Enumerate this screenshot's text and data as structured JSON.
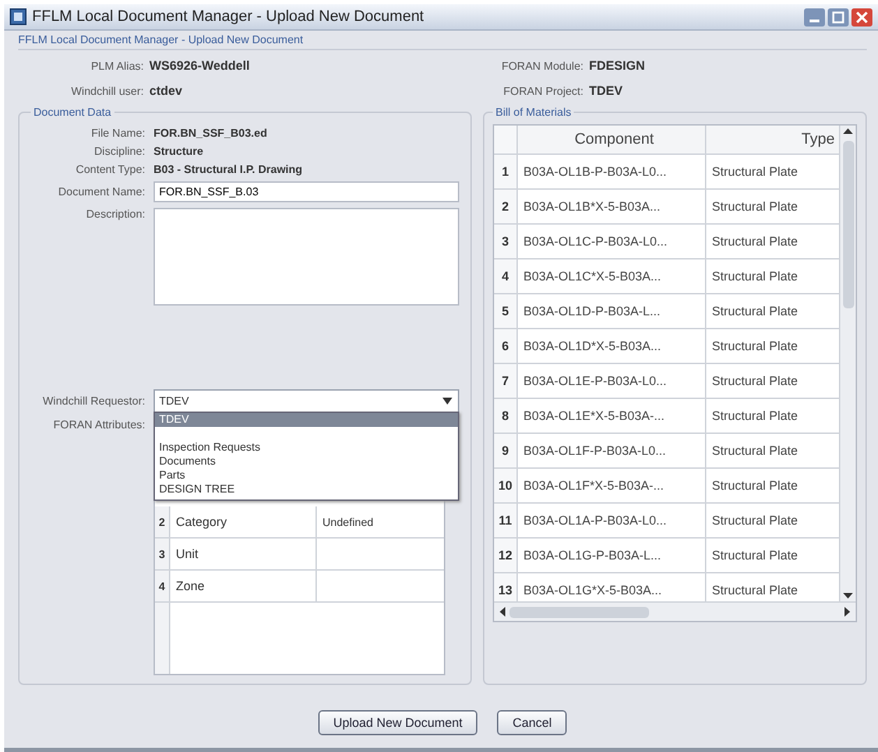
{
  "window": {
    "title": "FFLM Local Document Manager - Upload New Document"
  },
  "breadcrumb": "FFLM Local Document Manager - Upload New Document",
  "header_fields": [
    {
      "label": "PLM Alias:",
      "value": "WS6926-Weddell"
    },
    {
      "label": "FORAN Module:",
      "value": "FDESIGN"
    },
    {
      "label": "Windchill user:",
      "value": "ctdev"
    },
    {
      "label": "FORAN Project:",
      "value": "TDEV"
    }
  ],
  "document_data": {
    "title": "Document Data",
    "info": [
      {
        "label": "File Name:",
        "value": "FOR.BN_SSF_B03.ed"
      },
      {
        "label": "Discipline:",
        "value": "Structure"
      },
      {
        "label": "Content Type:",
        "value": "B03 - Structural I.P. Drawing"
      }
    ],
    "document_name": {
      "label": "Document Name:",
      "value": "FOR.BN_SSF_B.03"
    },
    "description": {
      "label": "Description:"
    },
    "requestor": {
      "label": "Windchill Requestor:",
      "value": "TDEV",
      "expanded": true,
      "options": [
        {
          "label": "TDEV",
          "selected": true
        },
        {
          "label": "Inspection Requests",
          "selected": false
        },
        {
          "label": "Documents",
          "selected": false
        },
        {
          "label": "Parts",
          "selected": false
        },
        {
          "label": "DESIGN TREE",
          "selected": false
        }
      ]
    },
    "foran_attributes": {
      "label": "FORAN Attributes:",
      "rows": [
        {
          "number": "2",
          "name": "Category",
          "value": "Undefined"
        },
        {
          "number": "3",
          "name": "Unit"
        },
        {
          "number": "4",
          "name": "Zone"
        }
      ]
    }
  },
  "bill_of_materials": {
    "title": "Bill of Materials",
    "columns": [
      "Component",
      "Type"
    ],
    "rows": [
      {
        "number": "1",
        "component": "B03A-OL1B-P-B03A-L0...",
        "type": "Structural Plate"
      },
      {
        "number": "2",
        "component": "B03A-OL1B*X-5-B03A...",
        "type": "Structural Plate"
      },
      {
        "number": "3",
        "component": "B03A-OL1C-P-B03A-L0...",
        "type": "Structural Plate"
      },
      {
        "number": "4",
        "component": "B03A-OL1C*X-5-B03A...",
        "type": "Structural Plate"
      },
      {
        "number": "5",
        "component": "B03A-OL1D-P-B03A-L...",
        "type": "Structural Plate"
      },
      {
        "number": "6",
        "component": "B03A-OL1D*X-5-B03A...",
        "type": "Structural Plate"
      },
      {
        "number": "7",
        "component": "B03A-OL1E-P-B03A-L0...",
        "type": "Structural Plate"
      },
      {
        "number": "8",
        "component": "B03A-OL1E*X-5-B03A-...",
        "type": "Structural Plate"
      },
      {
        "number": "9",
        "component": "B03A-OL1F-P-B03A-L0...",
        "type": "Structural Plate"
      },
      {
        "number": "10",
        "component": "B03A-OL1F*X-5-B03A-...",
        "type": "Structural Plate"
      },
      {
        "number": "11",
        "component": "B03A-OL1A-P-B03A-L0...",
        "type": "Structural Plate"
      },
      {
        "number": "12",
        "component": "B03A-OL1G-P-B03A-L...",
        "type": "Structural Plate"
      },
      {
        "number": "13",
        "component": "B03A-OL1G*X-5-B03A...",
        "type": "Structural Plate"
      }
    ]
  },
  "buttons": [
    "Upload New Document",
    "Cancel"
  ]
}
